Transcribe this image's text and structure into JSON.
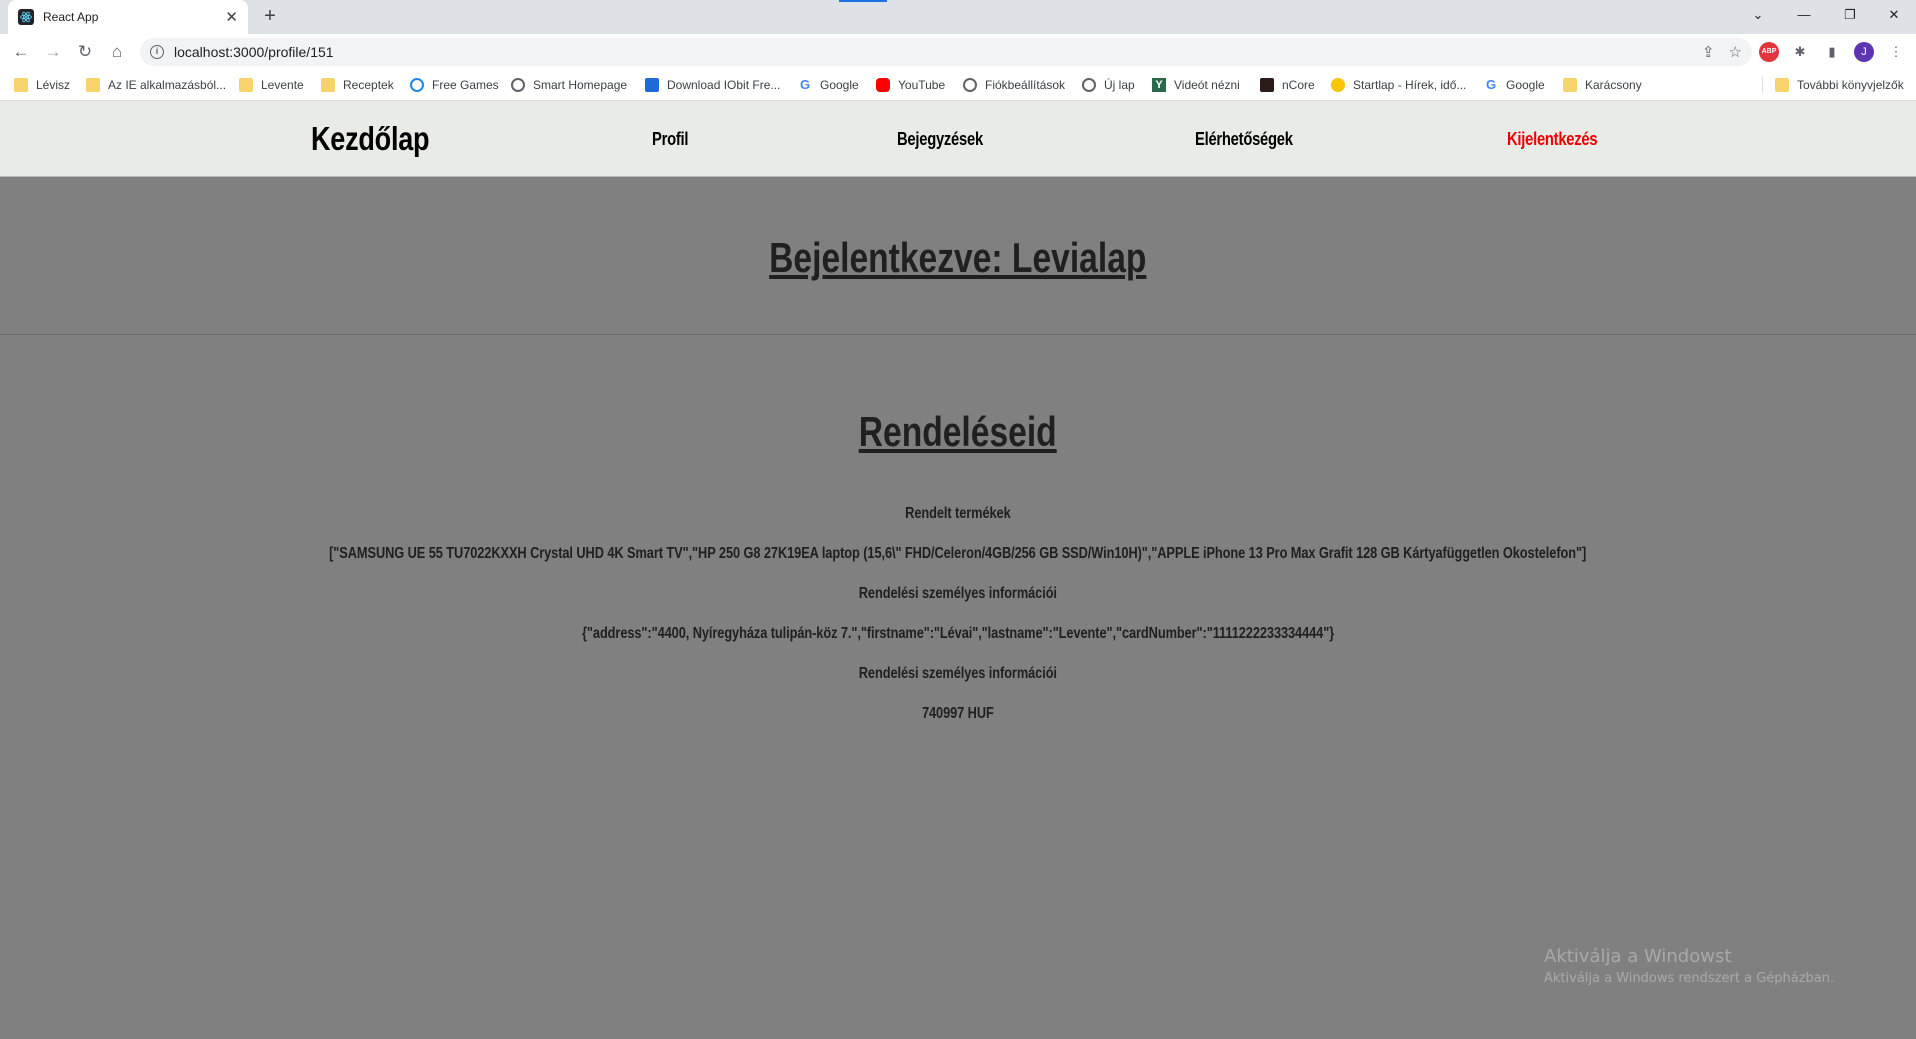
{
  "browser": {
    "tab_title": "React App",
    "url": "localhost:3000/profile/151",
    "profile_initial": "J",
    "extension_label": "ABP",
    "bookmarks": [
      {
        "label": "Lévisz",
        "icon": "folder-icon"
      },
      {
        "label": "Az IE alkalmazásból...",
        "icon": "folder-icon"
      },
      {
        "label": "Levente",
        "icon": "folder-icon"
      },
      {
        "label": "Receptek",
        "icon": "folder-icon"
      },
      {
        "label": "Free Games",
        "icon": "globe-icon"
      },
      {
        "label": "Smart Homepage",
        "icon": "globe-icon"
      },
      {
        "label": "Download IObit Fre...",
        "icon": "iobit-icon"
      },
      {
        "label": "Google",
        "icon": "google-icon"
      },
      {
        "label": "YouTube",
        "icon": "youtube-icon"
      },
      {
        "label": "Fiókbeállítások",
        "icon": "globe-icon"
      },
      {
        "label": "Új lap",
        "icon": "globe-icon"
      },
      {
        "label": "Videót nézni",
        "icon": "y-icon"
      },
      {
        "label": "nCore",
        "icon": "ncore-icon"
      },
      {
        "label": "Startlap - Hírek, idő...",
        "icon": "startlap-icon"
      },
      {
        "label": "Google",
        "icon": "google-icon"
      },
      {
        "label": "Karácsony",
        "icon": "folder-icon"
      }
    ],
    "other_bookmarks": "További könyvjelzők"
  },
  "navbar": {
    "brand": "Kezdőlap",
    "profile": "Profil",
    "posts": "Bejegyzések",
    "contacts": "Elérhetőségek",
    "logout": "Kijelentkezés"
  },
  "main": {
    "logged_in": "Bejelentkezve: Levialap",
    "orders_title": "Rendeléseid",
    "ordered_products_label": "Rendelt termékek",
    "ordered_products_value": "[\"SAMSUNG UE 55 TU7022KXXH Crystal UHD 4K Smart TV\",\"HP 250 G8 27K19EA laptop (15,6\\\" FHD/Celeron/4GB/256 GB SSD/Win10H)\",\"APPLE iPhone 13 Pro Max Grafit 128 GB Kártyafüggetlen Okostelefon\"]",
    "personal_info_label": "Rendelési személyes információi",
    "personal_info_value": "{\"address\":\"4400, Nyíregyháza tulipán-köz 7.\",\"firstname\":\"Lévai\",\"lastname\":\"Levente\",\"cardNumber\":\"1111222233334444\"}",
    "total_label": "Rendelési személyes információi",
    "total_value": "740997 HUF"
  },
  "watermark": {
    "line1": "Aktiválja a Windowst",
    "line2": "Aktiválja a Windows rendszert a Gépházban."
  },
  "colors": {
    "page_background": "#808080",
    "navbar_background": "#e9ebe6",
    "logout": "#ee0000"
  }
}
